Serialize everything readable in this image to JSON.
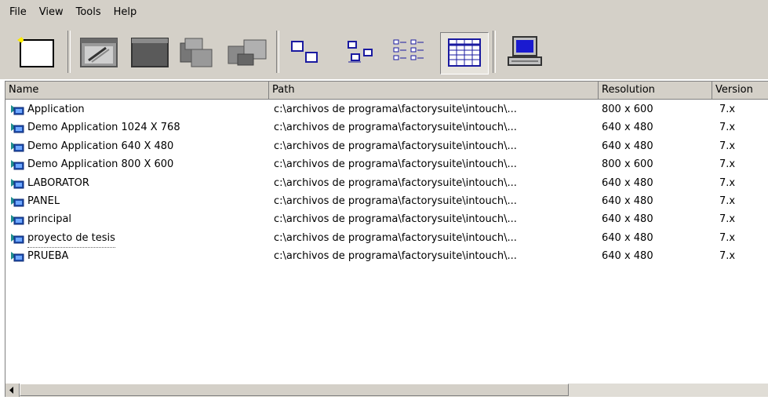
{
  "menu": [
    "File",
    "View",
    "Tools",
    "Help"
  ],
  "toolbar": {
    "buttons": [
      "new-application",
      "edit-application",
      "view-application",
      "develop-network",
      "view-network",
      "large-icons",
      "small-icons",
      "list-view",
      "details-view",
      "node-properties"
    ],
    "pressed": "details-view"
  },
  "columns": [
    "Name",
    "Path",
    "Resolution",
    "Version"
  ],
  "rows": [
    {
      "name": "Application",
      "path": "c:\\archivos de programa\\factorysuite\\intouch\\...",
      "resolution": "800 x 600",
      "version": "7.x"
    },
    {
      "name": "Demo Application 1024 X 768",
      "path": "c:\\archivos de programa\\factorysuite\\intouch\\...",
      "resolution": "640 x 480",
      "version": "7.x"
    },
    {
      "name": "Demo Application 640 X 480",
      "path": "c:\\archivos de programa\\factorysuite\\intouch\\...",
      "resolution": "640 x 480",
      "version": "7.x"
    },
    {
      "name": "Demo Application 800 X 600",
      "path": "c:\\archivos de programa\\factorysuite\\intouch\\...",
      "resolution": "800 x 600",
      "version": "7.x"
    },
    {
      "name": "LABORATOR",
      "path": "c:\\archivos de programa\\factorysuite\\intouch\\...",
      "resolution": "640 x 480",
      "version": "7.x"
    },
    {
      "name": "PANEL",
      "path": "c:\\archivos de programa\\factorysuite\\intouch\\...",
      "resolution": "640 x 480",
      "version": "7.x"
    },
    {
      "name": "principal",
      "path": "c:\\archivos de programa\\factorysuite\\intouch\\...",
      "resolution": "640 x 480",
      "version": "7.x"
    },
    {
      "name": "proyecto de tesis",
      "path": "c:\\archivos de programa\\factorysuite\\intouch\\...",
      "resolution": "640 x 480",
      "version": "7.x"
    },
    {
      "name": "PRUEBA",
      "path": "c:\\archivos de programa\\factorysuite\\intouch\\...",
      "resolution": "640 x 480",
      "version": "7.x"
    }
  ],
  "colors": {
    "chrome": "#d4d0c8",
    "list_bg": "#ffffff",
    "icon_teal": "#1f8f8f",
    "icon_blue": "#1e4fb0"
  }
}
